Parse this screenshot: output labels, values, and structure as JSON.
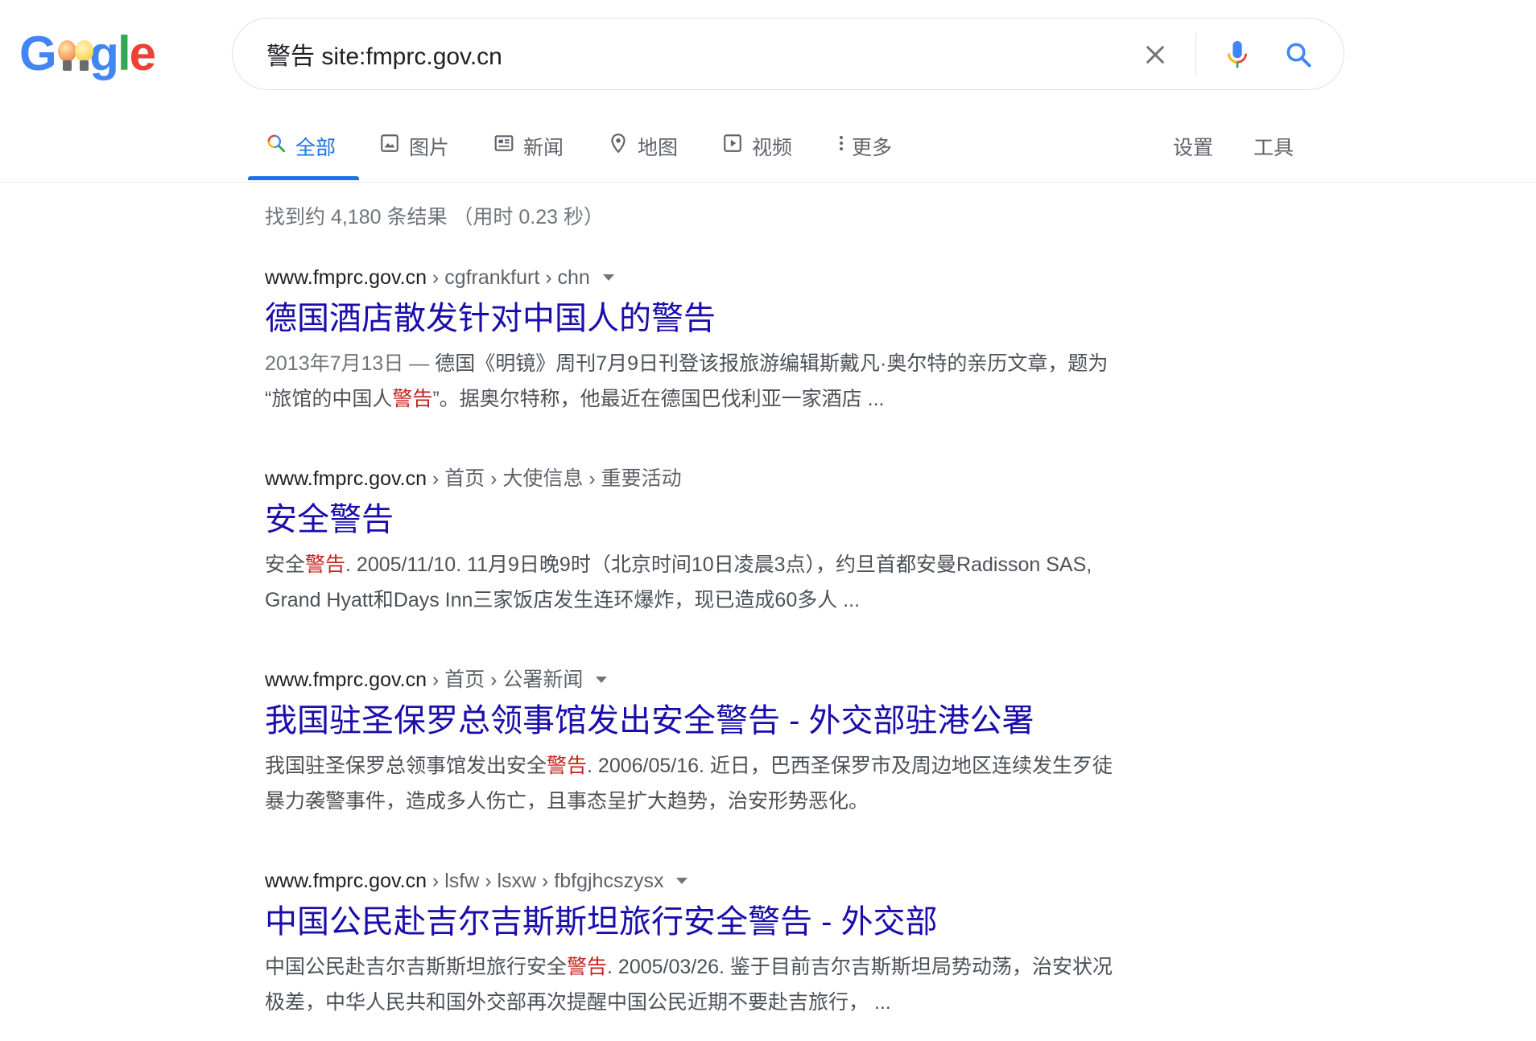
{
  "logo": {
    "letters": [
      "G",
      "o",
      "o",
      "g",
      "l",
      "e"
    ],
    "colors": {
      "blue": "#4285f4",
      "red": "#ea4335",
      "yellow": "#fbbc05",
      "green": "#34a853",
      "bulb_yellow": "#f9d548",
      "bulb_red": "#ef8a55"
    }
  },
  "search": {
    "query": "警告 site:fmprc.gov.cn",
    "icons": [
      "close-icon",
      "mic-icon",
      "search-icon"
    ]
  },
  "tabs": [
    {
      "label": "全部",
      "icon": "search-icon",
      "active": true
    },
    {
      "label": "图片",
      "icon": "image-icon"
    },
    {
      "label": "新闻",
      "icon": "news-icon"
    },
    {
      "label": "地图",
      "icon": "map-pin-icon"
    },
    {
      "label": "视频",
      "icon": "video-icon"
    },
    {
      "label": "更多",
      "icon": "more-vert-icon"
    }
  ],
  "tools": {
    "settings": "设置",
    "tools": "工具"
  },
  "stats": "找到约 4,180 条结果 （用时 0.23 秒）",
  "results": [
    {
      "site": "www.fmprc.gov.cn",
      "path": " › cgfrankfurt › chn",
      "title": "德国酒店散发针对中国人的警告",
      "date": "2013年7月13日 — ",
      "line1": "德国《明镜》周刊7月9日刊登该报旅游编辑斯戴凡·奥尔特的亲历文章，题为",
      "line2_pre": "“旅馆的中国人",
      "line2_hl": "警告",
      "line2_post": "”。据奥尔特称，他最近在德国巴伐利亚一家酒店 ..."
    },
    {
      "site": "www.fmprc.gov.cn",
      "path": " › 首页 › 大使信息 › 重要活动",
      "title": "安全警告",
      "line1_pre": "安全",
      "line1_hl": "警告",
      "line1_post": ". 2005/11/10. 11月9日晚9时（北京时间10日凌晨3点），约旦首都安曼Radisson SAS,",
      "line2": "Grand Hyatt和Days Inn三家饭店发生连环爆炸，现已造成60多人 ..."
    },
    {
      "site": "www.fmprc.gov.cn",
      "path": " › 首页 › 公署新闻",
      "title": "我国驻圣保罗总领事馆发出安全警告 - 外交部驻港公署",
      "line1_pre": "我国驻圣保罗总领事馆发出安全",
      "line1_hl": "警告",
      "line1_post": ". 2006/05/16. 近日，巴西圣保罗市及周边地区连续发生歹徒",
      "line2": "暴力袭警事件，造成多人伤亡，且事态呈扩大趋势，治安形势恶化。"
    },
    {
      "site": "www.fmprc.gov.cn",
      "path": " › lsfw › lsxw › fbfgjhcszysx",
      "title": "中国公民赴吉尔吉斯斯坦旅行安全警告 - 外交部",
      "line1_pre": "中国公民赴吉尔吉斯斯坦旅行安全",
      "line1_hl": "警告",
      "line1_post": ". 2005/03/26. 鉴于目前吉尔吉斯斯坦局势动荡，治安状况",
      "line2": "极差，中华人民共和国外交部再次提醒中国公民近期不要赴吉旅行， ..."
    }
  ]
}
